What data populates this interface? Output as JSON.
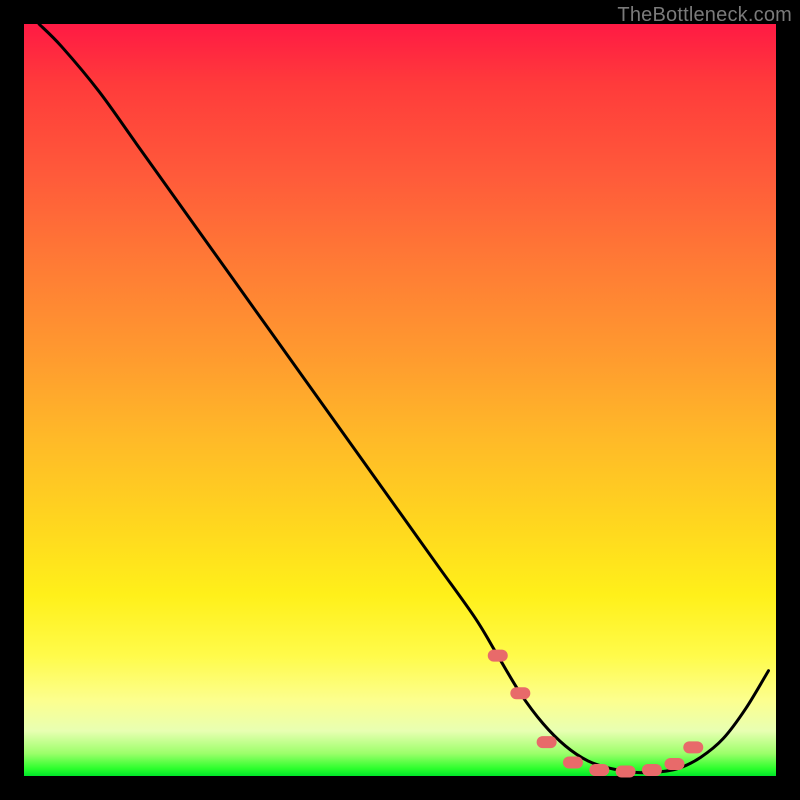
{
  "watermark": "TheBottleneck.com",
  "chart_data": {
    "type": "line",
    "title": "",
    "xlabel": "",
    "ylabel": "",
    "xlim": [
      0,
      100
    ],
    "ylim": [
      0,
      100
    ],
    "grid": false,
    "legend": false,
    "series": [
      {
        "name": "bottleneck-curve",
        "color": "#000000",
        "x": [
          2,
          5,
          10,
          15,
          20,
          25,
          30,
          35,
          40,
          45,
          50,
          55,
          60,
          63,
          66,
          69,
          72,
          75,
          78,
          81,
          84,
          87,
          90,
          93,
          96,
          99
        ],
        "y": [
          100,
          97,
          91,
          84,
          77,
          70,
          63,
          56,
          49,
          42,
          35,
          28,
          21,
          16,
          11,
          7,
          4,
          2,
          1,
          0.5,
          0.5,
          1,
          2.5,
          5,
          9,
          14
        ]
      }
    ],
    "markers": [
      {
        "name": "highlight-dots",
        "color": "#e86a6a",
        "shape": "rounded-rect",
        "x": [
          63,
          66,
          69.5,
          73,
          76.5,
          80,
          83.5,
          86.5,
          89
        ],
        "y": [
          16,
          11,
          4.5,
          1.8,
          0.8,
          0.6,
          0.8,
          1.6,
          3.8
        ]
      }
    ],
    "background_gradient": {
      "direction": "vertical",
      "stops": [
        {
          "pos": 0.0,
          "color": "#ff1a44"
        },
        {
          "pos": 0.2,
          "color": "#ff5a3a"
        },
        {
          "pos": 0.44,
          "color": "#ff9a2f"
        },
        {
          "pos": 0.66,
          "color": "#ffd51f"
        },
        {
          "pos": 0.84,
          "color": "#fffb4a"
        },
        {
          "pos": 0.94,
          "color": "#e8ffb2"
        },
        {
          "pos": 0.99,
          "color": "#2dff2d"
        },
        {
          "pos": 1.0,
          "color": "#00e62a"
        }
      ]
    }
  }
}
